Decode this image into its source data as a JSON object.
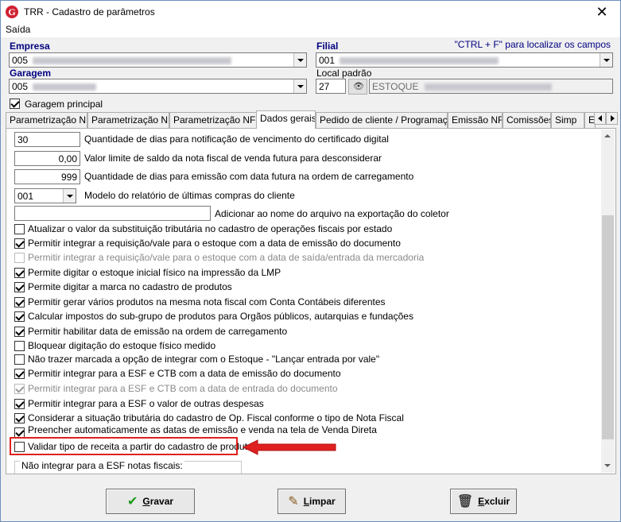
{
  "window": {
    "title": "TRR - Cadastro de parâmetros",
    "close": "✕"
  },
  "menu": {
    "saida": "Saída"
  },
  "form": {
    "empresa_label": "Empresa",
    "empresa_value": "005",
    "filial_label": "Filial",
    "filial_value": "001",
    "hint": "\"CTRL + F\" para localizar os campos",
    "garagem_label": "Garagem",
    "garagem_value": "005",
    "local_padrao_label": "Local padrão",
    "local_padrao_value": "27",
    "estoque_value": "ESTOQUE",
    "garagem_principal_label": "Garagem principal",
    "garagem_principal_checked": true
  },
  "tabs": [
    {
      "label": "Parametrização NF"
    },
    {
      "label": "Parametrização NF"
    },
    {
      "label": "Parametrização NF-e"
    },
    {
      "label": "Dados gerais"
    },
    {
      "label": "Pedido de cliente / Programação"
    },
    {
      "label": "Emissão NF"
    },
    {
      "label": "Comissões"
    },
    {
      "label": "Simp"
    },
    {
      "label": "E"
    }
  ],
  "panel": {
    "fields": [
      {
        "value": "30",
        "label": "Quantidade de dias para notificação de vencimento do certificado digital"
      },
      {
        "value": "0,00",
        "label": "Valor limite de saldo da nota fiscal de venda futura para desconsiderar"
      },
      {
        "value": "999",
        "label": "Quantidade de dias para emissão com data futura na ordem de carregamento"
      },
      {
        "value": "001",
        "label": "Modelo do relatório de últimas compras do cliente"
      },
      {
        "value": "",
        "label": "Adicionar ao nome do arquivo na exportação do coletor"
      }
    ],
    "checks": [
      {
        "label": "Atualizar o valor da substituição tributária no cadastro de operações fiscais por estado",
        "checked": false,
        "disabled": false
      },
      {
        "label": "Permitir integrar a requisição/vale para o estoque com a data de emissão do documento",
        "checked": true,
        "disabled": false
      },
      {
        "label": "Permitir integrar a requisição/vale para o estoque com a data de saída/entrada da mercadoria",
        "checked": false,
        "disabled": true
      },
      {
        "label": "Permite digitar o estoque inicial físico na impressão da LMP",
        "checked": true,
        "disabled": false
      },
      {
        "label": "Permite digitar a marca no cadastro de produtos",
        "checked": true,
        "disabled": false
      },
      {
        "label": "Permitir gerar vários produtos na mesma nota fiscal com Conta Contábeis diferentes",
        "checked": true,
        "disabled": false
      },
      {
        "label": "Calcular impostos do sub-grupo de produtos para Orgãos públicos, autarquias e fundações",
        "checked": true,
        "disabled": false
      },
      {
        "label": "Permitir habilitar data de emissão na ordem de carregamento",
        "checked": true,
        "disabled": false
      },
      {
        "label": "Bloquear digitação do estoque físico medido",
        "checked": false,
        "disabled": false
      },
      {
        "label": "Não trazer marcada a opção de integrar com o Estoque - \"Lançar entrada por vale\"",
        "checked": false,
        "disabled": false
      },
      {
        "label": "Permitir integrar para a ESF e CTB com a data de emissão do documento",
        "checked": true,
        "disabled": false
      },
      {
        "label": "Permitir integrar para a ESF e CTB com a data de entrada do documento",
        "checked": true,
        "disabled": true
      },
      {
        "label": "Permitir integrar para a ESF o valor de outras despesas",
        "checked": true,
        "disabled": false
      },
      {
        "label": "Considerar a situação tributária do cadastro de Op. Fiscal conforme o tipo de Nota Fiscal",
        "checked": true,
        "disabled": false
      },
      {
        "label": "Preencher automaticamente as datas de emissão e venda na tela de Venda Direta",
        "checked": true,
        "disabled": false
      },
      {
        "label": "Validar tipo de receita a partir do cadastro de produtos",
        "checked": false,
        "disabled": false
      }
    ],
    "group_legend": "Não integrar para a ESF notas fiscais:"
  },
  "buttons": {
    "gravar": {
      "first": "G",
      "rest": "ravar"
    },
    "limpar": {
      "first": "L",
      "rest": "impar"
    },
    "excluir": {
      "first": "E",
      "rest": "xcluir"
    }
  },
  "colors": {
    "accent": "#000080",
    "highlight": "#e02020",
    "app_icon": "#d02030"
  },
  "icons": [
    "app-logo-icon",
    "close-icon",
    "chevron-down-icon",
    "binoculars-icon",
    "checkmark-icon",
    "broom-icon",
    "trash-icon"
  ]
}
